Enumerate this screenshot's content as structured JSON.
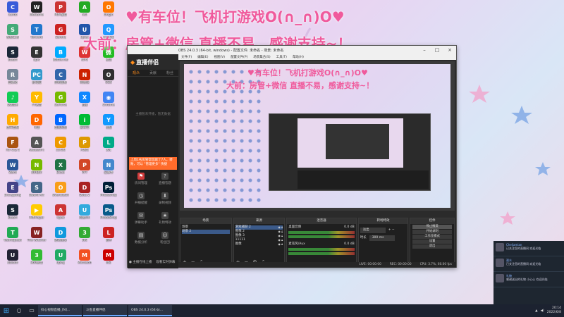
{
  "banner": {
    "line1": "♥有车位！飞机打游戏O(∩_∩)O♥",
    "line2": "大前：房管+微信 直播不易，感谢支持~！"
  },
  "desktop_icons": [
    {
      "label": "Cardo",
      "color": "#3a5bd9",
      "glyph": "C"
    },
    {
      "label": "WeGame",
      "color": "#222",
      "glyph": "W"
    },
    {
      "label": "PDF编辑",
      "color": "#c33",
      "glyph": "P"
    },
    {
      "label": "AIO",
      "color": "#2a2",
      "glyph": "A"
    },
    {
      "label": "Origin",
      "color": "#f70",
      "glyph": "O"
    },
    {
      "label": "系统工具",
      "color": "#4a7",
      "glyph": "S"
    },
    {
      "label": "Tencent",
      "color": "#27c",
      "glyph": "T"
    },
    {
      "label": "Garena",
      "color": "#c22",
      "glyph": "G"
    },
    {
      "label": "Uplay",
      "color": "#25a",
      "glyph": "U"
    },
    {
      "label": "腾讯QQ",
      "color": "#29f",
      "glyph": "Q"
    },
    {
      "label": "Steam",
      "color": "#1b2838",
      "glyph": "S"
    },
    {
      "label": "Epic",
      "color": "#333",
      "glyph": "E"
    },
    {
      "label": "Battle.net",
      "color": "#0af",
      "glyph": "B"
    },
    {
      "label": "WPS",
      "color": "#d33",
      "glyph": "W"
    },
    {
      "label": "微信",
      "color": "#2b2",
      "glyph": "微"
    },
    {
      "label": "回收站",
      "color": "#789",
      "glyph": "R"
    },
    {
      "label": "此电脑",
      "color": "#39c",
      "glyph": "PC"
    },
    {
      "label": "控制面板",
      "color": "#36a",
      "glyph": "C"
    },
    {
      "label": "网易云",
      "color": "#c20",
      "glyph": "N"
    },
    {
      "label": "OBS",
      "color": "#302e31",
      "glyph": "O"
    },
    {
      "label": "QQ音乐",
      "color": "#1c5",
      "glyph": "♪"
    },
    {
      "label": "YY语音",
      "color": "#fb0",
      "glyph": "Y"
    },
    {
      "label": "GeForce",
      "color": "#76b900",
      "glyph": "G"
    },
    {
      "label": "迅雷",
      "color": "#18f",
      "glyph": "X"
    },
    {
      "label": "Chrome",
      "color": "#4285f4",
      "glyph": "◉"
    },
    {
      "label": "虎牙直播",
      "color": "#fa0",
      "glyph": "H"
    },
    {
      "label": "斗鱼",
      "color": "#f60",
      "glyph": "D"
    },
    {
      "label": "百度网盘",
      "color": "#06f",
      "glyph": "B"
    },
    {
      "label": "爱奇艺",
      "color": "#0b3",
      "glyph": "i"
    },
    {
      "label": "优酷",
      "color": "#19f",
      "glyph": "Y"
    },
    {
      "label": "For Cry 5",
      "color": "#a51",
      "glyph": "F"
    },
    {
      "label": "Assassin's",
      "color": "#555",
      "glyph": "A"
    },
    {
      "label": "CS:GO",
      "color": "#e90",
      "glyph": "C"
    },
    {
      "label": "PUBG",
      "color": "#d90",
      "glyph": "P"
    },
    {
      "label": "LOL",
      "color": "#0a8",
      "glyph": "L"
    },
    {
      "label": "Word",
      "color": "#2b5797",
      "glyph": "W"
    },
    {
      "label": "NVIDIA",
      "color": "#76b900",
      "glyph": "N"
    },
    {
      "label": "Excel",
      "color": "#217346",
      "glyph": "X"
    },
    {
      "label": "PPT",
      "color": "#d24726",
      "glyph": "P"
    },
    {
      "label": "记事本",
      "color": "#48c",
      "glyph": "N"
    },
    {
      "label": "Encrypting",
      "color": "#448",
      "glyph": "E"
    },
    {
      "label": "Sword Art",
      "color": "#468",
      "glyph": "S"
    },
    {
      "label": "Overwatch",
      "color": "#f99e1a",
      "glyph": "O"
    },
    {
      "label": "Dota 2",
      "color": "#a22",
      "glyph": "D"
    },
    {
      "label": "Photoshop",
      "color": "#001e36",
      "glyph": "Ps"
    },
    {
      "label": "Steam",
      "color": "#1b2838",
      "glyph": "S"
    },
    {
      "label": "PotPlayer",
      "color": "#fc0",
      "glyph": "▶"
    },
    {
      "label": "Apex",
      "color": "#c33",
      "glyph": "A"
    },
    {
      "label": "网易UU",
      "color": "#3ad",
      "glyph": "U"
    },
    {
      "label": "PhotoShop",
      "color": "#0a5a8a",
      "glyph": "Ps"
    },
    {
      "label": "TeamSpeak",
      "color": "#2a5",
      "glyph": "T"
    },
    {
      "label": "The Witcher",
      "color": "#822",
      "glyph": "W"
    },
    {
      "label": "驱动精灵",
      "color": "#19d",
      "glyph": "D"
    },
    {
      "label": "360",
      "color": "#3a3",
      "glyph": "3"
    },
    {
      "label": "雷神",
      "color": "#c22",
      "glyph": "L"
    },
    {
      "label": "Ubisoft",
      "color": "#223",
      "glyph": "U"
    },
    {
      "label": "360杀毒",
      "color": "#3b3",
      "glyph": "3"
    },
    {
      "label": "Uplay",
      "color": "#2a6",
      "glyph": "U"
    },
    {
      "label": "Microsoft",
      "color": "#f25022",
      "glyph": "M"
    },
    {
      "label": "MSI",
      "color": "#c00",
      "glyph": "M"
    }
  ],
  "obs": {
    "title": "OBS 24.0.3 (64-bit, windows) - 配置文件: 未命名 - 场景: 未命名",
    "menu": [
      "文件(F)",
      "编辑(E)",
      "视图(V)",
      "配置文件(P)",
      "场景集合(S)",
      "工具(T)",
      "帮助(H)"
    ],
    "live_panel": {
      "logo": "直播伴侣",
      "tabs": [
        "观众",
        "贡献",
        "粉丝"
      ],
      "empty": "主播暂未开播，暂无数据",
      "notice": "上周1名房管帮您踢了7人，转账，可以 \"管理更多\" 快捷",
      "buttons": [
        {
          "label": "房间管理",
          "icon": "⚑"
        },
        {
          "label": "直播答题",
          "icon": "?"
        },
        {
          "label": "开播提醒",
          "icon": "◷"
        },
        {
          "label": "录制视频",
          "icon": "⬇"
        },
        {
          "label": "弹幕助手",
          "icon": "✉"
        },
        {
          "label": "礼物特效",
          "icon": "★"
        },
        {
          "label": "数据分析",
          "icon": "▤"
        },
        {
          "label": "粉丝团",
          "icon": "☺"
        }
      ],
      "footer": [
        "● 主播在线上播",
        "观看实时弹幕"
      ]
    },
    "docks": {
      "scenes_title": "场景",
      "scenes": [
        "场景",
        "场景 2"
      ],
      "sources_title": "来源",
      "sources": [
        "游戏捕获 2",
        "图像 2",
        "图像 3",
        "11111",
        "图像"
      ],
      "mixer_title": "混音器",
      "mixer": [
        {
          "name": "桌面音频",
          "db": "0.0 dB"
        },
        {
          "name": "麦克风/Aux",
          "db": "0.0 dB"
        }
      ],
      "transitions_title": "转场特效",
      "transition": "淡出",
      "duration_label": "时长",
      "duration": "300 ms",
      "controls_title": "控件",
      "controls": [
        "停止推流",
        "开始录制",
        "工作室模式",
        "设置",
        "退出"
      ]
    },
    "status": {
      "live": "LIVE: 00:00:00",
      "rec": "REC: 00:00:00",
      "cpu": "CPU: 3.7%, 60.00 fps"
    }
  },
  "chat": [
    {
      "name": "Cheljamian",
      "text": "已关注您的直播间 欢迎光临"
    },
    {
      "name": "观众",
      "text": "已关注您的直播间 欢迎光临"
    },
    {
      "name": "礼物",
      "text": "感谢送出的礼物 小心心 欢迎光临"
    }
  ],
  "taskbar": {
    "tasks": [
      "抖心视频直播_[N]…",
      "斗鱼直播伴侣",
      "OBS 24.0.3 (64-bi…"
    ],
    "time": "20:14",
    "date": "2022/6/8"
  }
}
